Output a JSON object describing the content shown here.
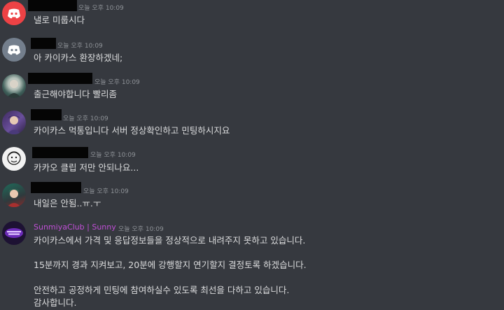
{
  "messages": [
    {
      "timestamp": "오늘 오후 10:09",
      "lines": [
        "낼로 미룹시다"
      ],
      "avatar": "discord-red"
    },
    {
      "timestamp": "오늘 오후 10:09",
      "lines": [
        "아 카이카스 환장하겠네;"
      ],
      "avatar": "discord-gray"
    },
    {
      "timestamp": "오늘 오후 10:09",
      "lines": [
        "출근해야합니다 빨리좀"
      ],
      "avatar": "photo-teal"
    },
    {
      "timestamp": "오늘 오후 10:09",
      "lines": [
        "카이카스 먹통입니다 서버 정상확인하고 민팅하시지요"
      ],
      "avatar": "photo-purple"
    },
    {
      "timestamp": "오늘 오후 10:09",
      "lines": [
        "카카오 클립 저만 안되나요..."
      ],
      "avatar": "photo-sketch"
    },
    {
      "timestamp": "오늘 오후 10:09",
      "lines": [
        "내일은 안됨..ㅠ.ㅜ"
      ],
      "avatar": "photo-green"
    },
    {
      "username": "SunmiyaClub | Sunny",
      "timestamp": "오늘 오후 10:09",
      "avatar": "sunmiya-logo",
      "lines": [
        "카이카스에서 가격 및 응답정보들을 정상적으로 내려주지 못하고 있습니다.",
        "15분까지 경과 지켜보고, 20분에 강행할지 연기할지 결정토록 하겠습니다.",
        "안전하고 공정하게 민팅에 참여하실수 있도록 최선을 다하고 있습니다.",
        "감사합니다."
      ]
    }
  ],
  "colors": {
    "background": "#36393f",
    "text": "#dcddde",
    "timestamp": "#8e9297",
    "username_accent": "#c04fd6"
  }
}
